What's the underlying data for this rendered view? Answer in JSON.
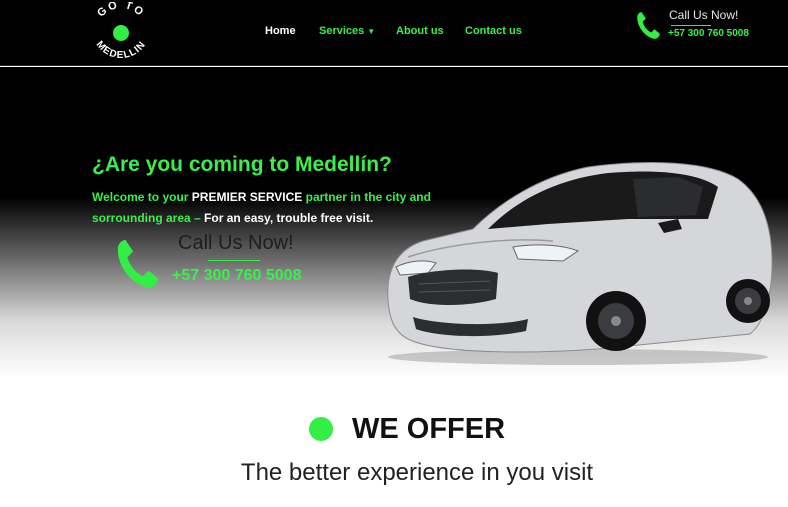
{
  "header": {
    "logo_text_top": "GO TO",
    "logo_text_bottom": "MEDELLIN",
    "nav": {
      "home": "Home",
      "services": "Services",
      "about": "About us",
      "contact": "Contact us"
    },
    "call_label": "Call Us Now!",
    "call_number": "+57 300 760 5008"
  },
  "hero": {
    "title": "¿Are you coming to Medellín?",
    "text_part1": "Welcome to your ",
    "text_highlight": "PREMIER SERVICE",
    "text_part2": " partner in the city and sorrounding area – ",
    "text_part3": "For an easy, trouble free visit.",
    "call_label": "Call Us Now!",
    "call_number": "+57 300 760 5008"
  },
  "offer": {
    "title": "WE OFFER",
    "subtitle": "The better experience in you visit"
  },
  "colors": {
    "accent": "#39f04a",
    "background": "#000000",
    "text_dark": "#111111"
  },
  "icons": {
    "phone": "phone-icon",
    "dropdown": "chevron-down-icon",
    "car": "car-image"
  }
}
